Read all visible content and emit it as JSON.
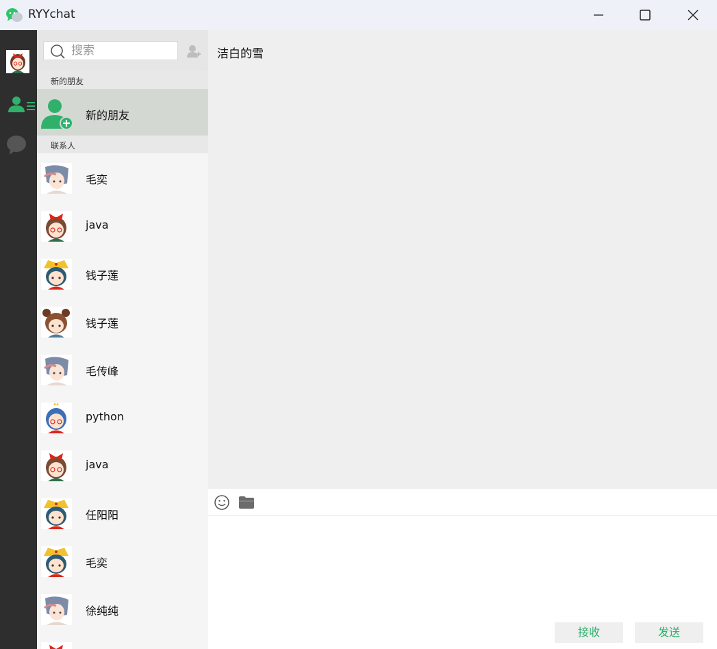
{
  "app": {
    "title": "RYYchat",
    "logo_icon": "wechat-logo-icon",
    "accent_color": "#2fb16b"
  },
  "window_controls": {
    "minimize_icon": "minimize-icon",
    "maximize_icon": "maximize-icon",
    "close_icon": "close-icon"
  },
  "rail": {
    "items": [
      {
        "name": "user-avatar",
        "icon": "avatar"
      },
      {
        "name": "contacts",
        "icon": "contacts-icon",
        "active": true
      },
      {
        "name": "chats",
        "icon": "chat-bubble-icon"
      }
    ]
  },
  "search": {
    "placeholder": "搜索",
    "value": "",
    "icon": "search-icon",
    "add_icon": "add-friend-icon"
  },
  "sections": {
    "new_friends": "新的朋友",
    "contacts": "联系人"
  },
  "new_friend_entry": {
    "label": "新的朋友",
    "icon": "add-friend-icon"
  },
  "contacts": [
    {
      "name": "毛奕",
      "avatar": "avatar-a"
    },
    {
      "name": "java",
      "avatar": "avatar-b"
    },
    {
      "name": "钱子莲",
      "avatar": "avatar-c"
    },
    {
      "name": "钱子莲",
      "avatar": "avatar-d"
    },
    {
      "name": "毛传峰",
      "avatar": "avatar-a"
    },
    {
      "name": "python",
      "avatar": "avatar-e"
    },
    {
      "name": "java",
      "avatar": "avatar-b"
    },
    {
      "name": "任阳阳",
      "avatar": "avatar-c"
    },
    {
      "name": "毛奕",
      "avatar": "avatar-c"
    },
    {
      "name": "徐纯纯",
      "avatar": "avatar-a"
    }
  ],
  "chat": {
    "title": "洁白的雪",
    "toolbar": {
      "emoji_icon": "emoji-icon",
      "file_icon": "folder-icon"
    },
    "compose_value": "",
    "receive_label": "接收",
    "send_label": "发送"
  }
}
